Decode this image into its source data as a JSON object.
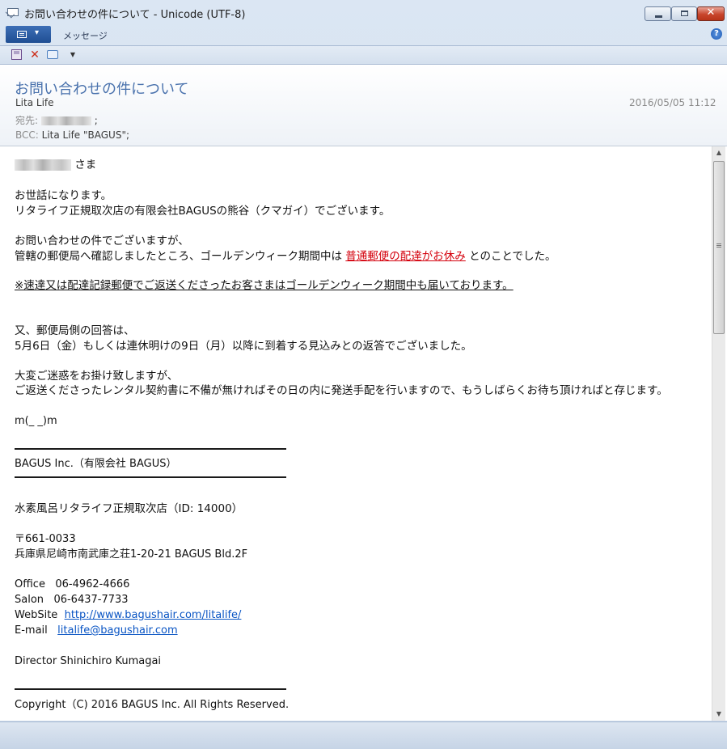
{
  "window": {
    "title": "お問い合わせの件について - Unicode (UTF-8)",
    "close_glyph": "✕"
  },
  "ribbon": {
    "tab_label": "メッセージ",
    "help_glyph": "?",
    "menu_caret": "▾"
  },
  "toolbar": {
    "delete_glyph": "✕",
    "more_glyph": "▼"
  },
  "header": {
    "subject": "お問い合わせの件について",
    "sender": "Lita Life",
    "date": "2016/05/05 11:12",
    "to_label": "宛先:",
    "to_suffix": ";",
    "bcc_label": "BCC:",
    "bcc_value": "Lita Life \"BAGUS\";"
  },
  "body": {
    "salutation_suffix": " さま",
    "greeting_1": "お世話になります。",
    "greeting_2": "リタライフ正規取次店の有限会社BAGUSの熊谷（クマガイ）でございます。",
    "para1_line1": "お問い合わせの件でございますが、",
    "para1_line2_pre": "管轄の郵便局へ確認しましたところ、ゴールデンウィーク期間中は ",
    "para1_line2_red": "普通郵便の配達がお休み",
    "para1_line2_post": " とのことでした。",
    "notice": "※速達又は配達記録郵便でご返送くださったお客さまはゴールデンウィーク期間中も届いております。",
    "para2_line1": "又、郵便局側の回答は、",
    "para2_line2": "5月6日（金）もしくは連休明けの9日（月）以降に到着する見込みとの返答でございました。",
    "para3_line1": "大変ご迷惑をお掛け致しますが、",
    "para3_line2": "ご返送くださったレンタル契約書に不備が無ければその日の内に発送手配を行いますので、もうしばらくお待ち頂ければと存じます。",
    "emoticon": "m(_ _)m"
  },
  "signature": {
    "company": "BAGUS Inc.（有限会社 BAGUS）",
    "store": "水素風呂リタライフ正規取次店（ID: 14000）",
    "postal": "〒661-0033",
    "address": "兵庫県尼崎市南武庫之荘1-20-21 BAGUS Bld.2F",
    "office_label": "Office",
    "office_tel": "06-4962-4666",
    "salon_label": "Salon",
    "salon_tel": "06-6437-7733",
    "website_label": "WebSite",
    "website_url": "http://www.bagushair.com/litalife/",
    "email_label": "E-mail",
    "email": "litalife@bagushair.com",
    "director": "Director Shinichiro Kumagai",
    "copyright": "Copyright（C) 2016 BAGUS Inc. All Rights Reserved."
  },
  "scrollbar": {
    "up_glyph": "▲",
    "down_glyph": "▼"
  }
}
